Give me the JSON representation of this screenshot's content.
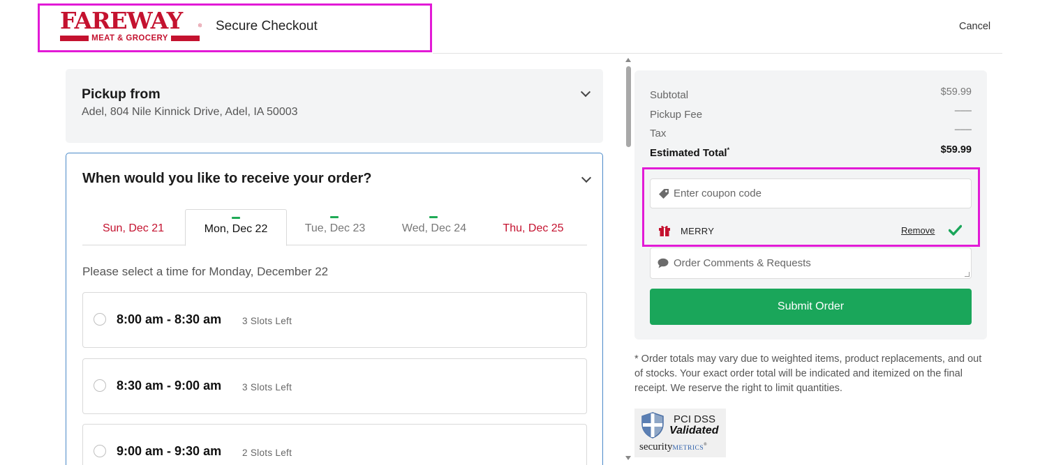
{
  "header": {
    "logo_word": "FAREWAY",
    "logo_sub": "MEAT & GROCERY",
    "logo_reg": "®",
    "title": "Secure Checkout",
    "cancel": "Cancel"
  },
  "pickup": {
    "title": "Pickup from",
    "address": "Adel, 804 Nile Kinnick Drive, Adel, IA 50003"
  },
  "delivery": {
    "title": "When would you like to receive your order?",
    "tabs": [
      {
        "label": "Sun, Dec 21",
        "state": "holiday"
      },
      {
        "label": "Mon, Dec 22",
        "state": "selected"
      },
      {
        "label": "Tue, Dec 23",
        "state": "available"
      },
      {
        "label": "Wed, Dec 24",
        "state": "available"
      },
      {
        "label": "Thu, Dec 25",
        "state": "holiday"
      }
    ],
    "select_label": "Please select a time for Monday, December 22",
    "slots": [
      {
        "time": "8:00 am - 8:30 am",
        "left": "3 Slots Left"
      },
      {
        "time": "8:30 am - 9:00 am",
        "left": "3 Slots Left"
      },
      {
        "time": "9:00 am - 9:30 am",
        "left": "2 Slots Left"
      }
    ]
  },
  "summary": {
    "subtotal_label": "Subtotal",
    "subtotal_value": "$59.99",
    "fee_label": "Pickup Fee",
    "fee_value": "–––",
    "tax_label": "Tax",
    "tax_value": "–––",
    "total_label": "Estimated Total",
    "total_marker": "*",
    "total_value": "$59.99"
  },
  "coupon": {
    "placeholder": "Enter coupon code",
    "applied_code": "MERRY",
    "remove_label": "Remove"
  },
  "comments": {
    "placeholder": "Order Comments & Requests"
  },
  "submit_label": "Submit Order",
  "disclaimer": "* Order totals may vary due to weighted items, product replacements, and out of stocks. Your exact order total will be indicated and itemized on the final receipt. We reserve the right to limit quantities.",
  "badge": {
    "line1": "PCI DSS",
    "line2": "Validated",
    "brand_a": "security",
    "brand_b": "METRICS",
    "brand_reg": "®"
  },
  "colors": {
    "brand_red": "#c4122f",
    "accent_green": "#1aa65a",
    "highlight_magenta": "#e21ad6",
    "focus_blue": "#4a89c8"
  },
  "icons": [
    "tag-icon",
    "gift-icon",
    "checkmark-icon",
    "comment-icon",
    "chevron-down-icon",
    "shield-icon"
  ]
}
